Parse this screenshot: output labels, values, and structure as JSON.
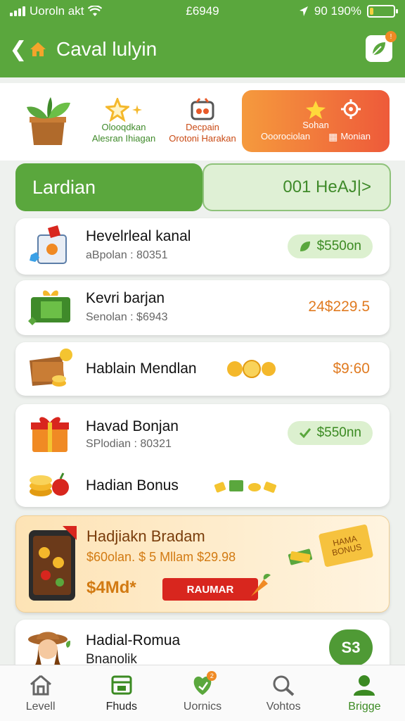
{
  "status": {
    "carrier": "Uoroln akt",
    "time": "£6949",
    "battery": "90 190%",
    "battery_level": 0.15
  },
  "header": {
    "title": "Caval lulyin"
  },
  "categories": [
    {
      "line1": "",
      "line2": ""
    },
    {
      "line1": "Olooqdkan",
      "line2": "Alesran Ihiagan"
    },
    {
      "line1": "Decpain",
      "line2": "Orotoni Harakan"
    },
    {
      "line1": "Sohan",
      "line2": "Ooorociolan",
      "extra": "Monian"
    }
  ],
  "segment": {
    "left": "Lardian",
    "right": "001 HeAJ|>"
  },
  "items": [
    {
      "name": "Hevelrleal kanal",
      "sub": "aBpolan : 80351",
      "amount": "$550on"
    },
    {
      "name": "Kevri barjan",
      "sub": "Senolan : $6943",
      "amount": "24$229.5"
    },
    {
      "name": "Hablain Mendlan",
      "amount": "$9:60"
    },
    {
      "name": "Havad Bonjan",
      "sub": "SPlodian : 80321",
      "amount": "$550nn",
      "name2": "Hadian Bonus"
    }
  ],
  "promo": {
    "title": "Hadjiakn Bradam",
    "line": "$60olan. $ 5 Mllam $29.98",
    "big": "$4Md*",
    "button": "RAUMAR",
    "ticket": "HAMA BONUS"
  },
  "last_item": {
    "name": "Hadial-Romua",
    "sub": "Bnanolik",
    "badge": "S3"
  },
  "nav": [
    {
      "label": "Levell"
    },
    {
      "label": "Fhuds"
    },
    {
      "label": "Uornics"
    },
    {
      "label": "Vohtos"
    },
    {
      "label": "Brigge"
    }
  ],
  "colors": {
    "brand": "#5aa73d",
    "accent": "#f08a24",
    "price": "#e07b21"
  }
}
